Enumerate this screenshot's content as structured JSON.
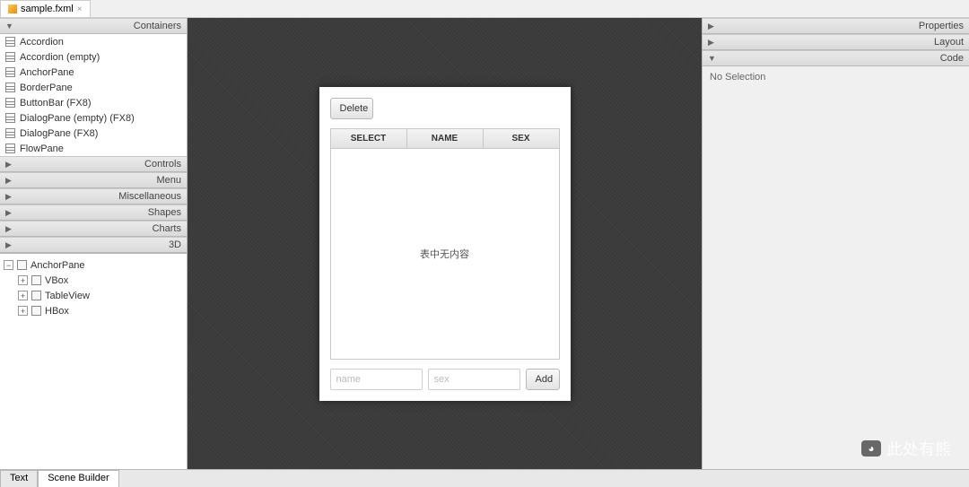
{
  "file_tab": {
    "label": "sample.fxml"
  },
  "library": {
    "sections": [
      {
        "title": "Containers",
        "expanded": true,
        "items": [
          "Accordion",
          "Accordion  (empty)",
          "AnchorPane",
          "BorderPane",
          "ButtonBar   (FX8)",
          "DialogPane (empty)   (FX8)",
          "DialogPane   (FX8)",
          "FlowPane"
        ]
      },
      {
        "title": "Controls",
        "expanded": false
      },
      {
        "title": "Menu",
        "expanded": false
      },
      {
        "title": "Miscellaneous",
        "expanded": false
      },
      {
        "title": "Shapes",
        "expanded": false
      },
      {
        "title": "Charts",
        "expanded": false
      },
      {
        "title": "3D",
        "expanded": false
      }
    ]
  },
  "hierarchy": {
    "root": {
      "label": "AnchorPane",
      "expanded": true,
      "children": [
        {
          "label": "VBox",
          "expanded": false
        },
        {
          "label": "TableView",
          "expanded": false
        },
        {
          "label": "HBox",
          "expanded": false
        }
      ]
    }
  },
  "canvas": {
    "delete_label": "Delete",
    "columns": [
      "SELECT",
      "NAME",
      "SEX"
    ],
    "empty_text": "表中无内容",
    "name_placeholder": "name",
    "sex_placeholder": "sex",
    "add_label": "Add"
  },
  "inspector": {
    "sections": [
      {
        "title": "Properties",
        "expanded": false
      },
      {
        "title": "Layout",
        "expanded": false
      },
      {
        "title": "Code",
        "expanded": true
      }
    ],
    "body_text": "No Selection"
  },
  "bottom_tabs": [
    "Text",
    "Scene Builder"
  ],
  "bottom_active": 1,
  "watermark": "此处有熊"
}
